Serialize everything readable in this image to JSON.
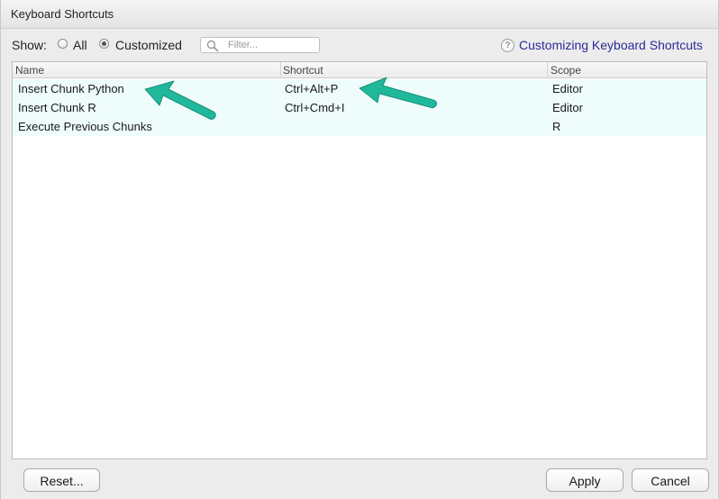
{
  "window": {
    "title": "Keyboard Shortcuts"
  },
  "toolbar": {
    "show_label": "Show:",
    "options": [
      {
        "label": "All",
        "selected": false
      },
      {
        "label": "Customized",
        "selected": true
      }
    ],
    "filter_placeholder": "Filter...",
    "filter_value": "",
    "help_link": "Customizing Keyboard Shortcuts"
  },
  "table": {
    "columns": [
      "Name",
      "Shortcut",
      "Scope"
    ],
    "rows": [
      {
        "name": "Insert Chunk Python",
        "shortcut": "Ctrl+Alt+P",
        "scope": "Editor"
      },
      {
        "name": "Insert Chunk R",
        "shortcut": "Ctrl+Cmd+I",
        "scope": "Editor"
      },
      {
        "name": "Execute Previous Chunks",
        "shortcut": "",
        "scope": "R"
      }
    ]
  },
  "buttons": {
    "reset": "Reset...",
    "apply": "Apply",
    "cancel": "Cancel"
  },
  "annotations": {
    "arrow_color": "#1fb89a",
    "arrows": [
      "arrow-pointing-at-insert-chunk-python",
      "arrow-pointing-at-ctrl-alt-p"
    ]
  },
  "colors": {
    "row_highlight": "#eefcfc",
    "link": "#2a2a9a"
  }
}
